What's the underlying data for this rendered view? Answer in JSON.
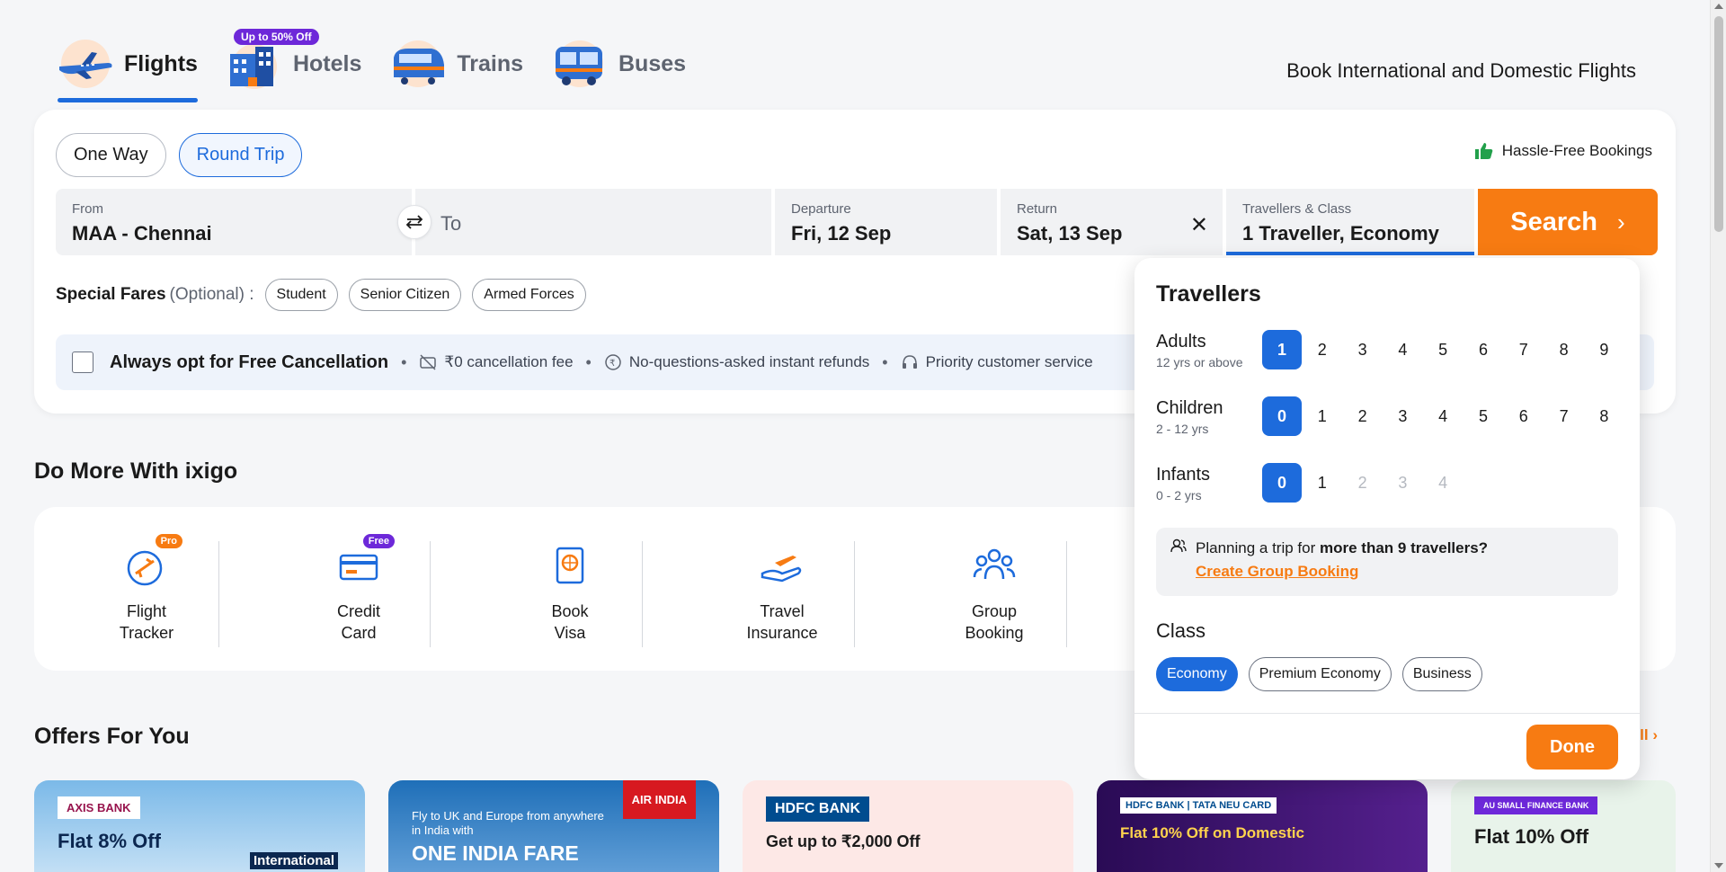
{
  "tabs": [
    {
      "label": "Flights",
      "active": true,
      "icon": "plane-icon"
    },
    {
      "label": "Hotels",
      "active": false,
      "icon": "hotel-icon",
      "badge": "Up to 50% Off"
    },
    {
      "label": "Trains",
      "active": false,
      "icon": "train-icon"
    },
    {
      "label": "Buses",
      "active": false,
      "icon": "bus-icon"
    }
  ],
  "header": {
    "tagline": "Book International and Domestic Flights"
  },
  "search": {
    "trip_types": [
      "One Way",
      "Round Trip"
    ],
    "selected_trip_type": "Round Trip",
    "hassle_free": "Hassle-Free Bookings",
    "from": {
      "label": "From",
      "value": "MAA - Chennai"
    },
    "to": {
      "placeholder": "To"
    },
    "departure": {
      "label": "Departure",
      "value": "Fri, 12 Sep"
    },
    "return": {
      "label": "Return",
      "value": "Sat, 13 Sep"
    },
    "travellers": {
      "label": "Travellers & Class",
      "value": "1 Traveller, Economy"
    },
    "search_label": "Search",
    "special_fares": {
      "title": "Special Fares",
      "optional": "(Optional) :",
      "options": [
        "Student",
        "Senior Citizen",
        "Armed Forces"
      ]
    },
    "free_cancellation": {
      "title": "Always opt for Free Cancellation",
      "benefits": [
        "₹0 cancellation fee",
        "No-questions-asked instant refunds",
        "Priority customer service"
      ]
    }
  },
  "do_more": {
    "title": "Do More With ixigo",
    "items": [
      {
        "line1": "Flight",
        "line2": "Tracker",
        "badge": "Pro",
        "icon": "flight-tracker-icon"
      },
      {
        "line1": "Credit",
        "line2": "Card",
        "badge": "Free",
        "icon": "credit-card-icon"
      },
      {
        "line1": "Book",
        "line2": "Visa",
        "icon": "passport-icon"
      },
      {
        "line1": "Travel",
        "line2": "Insurance",
        "icon": "insurance-icon"
      },
      {
        "line1": "Group",
        "line2": "Booking",
        "icon": "group-icon"
      }
    ]
  },
  "offers": {
    "title": "Offers For You",
    "view_all": "All",
    "cards": [
      {
        "logo": "AXIS BANK",
        "headline": "Flat 8% Off",
        "tag": "International"
      },
      {
        "logo": "AIR INDIA",
        "headline": "ONE INDIA FARE",
        "sub": "Fly to UK and Europe from anywhere in India with"
      },
      {
        "logo": "HDFC BANK",
        "headline": "Get up to ₹2,000 Off"
      },
      {
        "logo": "HDFC BANK | TATA NEU CARD",
        "headline": "Flat 10% Off on Domestic"
      },
      {
        "logo": "AU SMALL FINANCE BANK",
        "headline": "Flat 10% Off"
      }
    ]
  },
  "travellers_popover": {
    "title": "Travellers",
    "rows": [
      {
        "label": "Adults",
        "sub": "12 yrs or above",
        "options": [
          "1",
          "2",
          "3",
          "4",
          "5",
          "6",
          "7",
          "8",
          "9"
        ],
        "selected": "1",
        "disabled": []
      },
      {
        "label": "Children",
        "sub": "2 - 12 yrs",
        "options": [
          "0",
          "1",
          "2",
          "3",
          "4",
          "5",
          "6",
          "7",
          "8"
        ],
        "selected": "0",
        "disabled": []
      },
      {
        "label": "Infants",
        "sub": "0 - 2 yrs",
        "options": [
          "0",
          "1",
          "2",
          "3",
          "4"
        ],
        "selected": "0",
        "disabled": [
          "2",
          "3",
          "4"
        ]
      }
    ],
    "group_prompt_prefix": "Planning a trip for",
    "group_prompt_bold": "more than 9 travellers?",
    "group_link": "Create Group Booking",
    "class_title": "Class",
    "classes": [
      "Economy",
      "Premium Economy",
      "Business"
    ],
    "selected_class": "Economy",
    "done_label": "Done"
  },
  "colors": {
    "accent": "#1d6bdc",
    "cta": "#f77b12"
  }
}
